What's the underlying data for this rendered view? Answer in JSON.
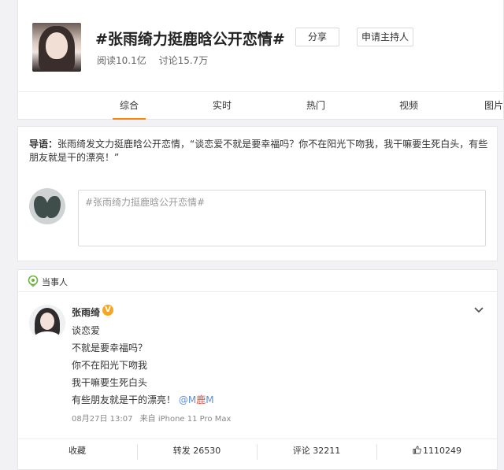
{
  "topic": {
    "title": "#张雨绮力挺鹿晗公开恋情#",
    "share_label": "分享",
    "apply_host_label": "申请主持人",
    "reads": "阅读10.1亿",
    "discussions": "讨论15.7万"
  },
  "tabs": [
    {
      "label": "综合",
      "active": true
    },
    {
      "label": "实时",
      "active": false
    },
    {
      "label": "热门",
      "active": false
    },
    {
      "label": "视频",
      "active": false
    },
    {
      "label": "图片",
      "active": false
    }
  ],
  "intro": {
    "prefix": "导语：",
    "text": "张雨绮发文力挺鹿晗公开恋情，“谈恋爱不就是要幸福吗？你不在阳光下吻我，我干嘛要生死白头，有些朋友就是干的漂亮！”"
  },
  "composer": {
    "placeholder": "#张雨绮力挺鹿晗公开恋情#"
  },
  "post": {
    "section_label": "当事人",
    "author": "张雨绮",
    "verified_badge": "V",
    "lines": [
      "谈恋爱",
      "不就是要幸福吗？",
      "你不在阳光下吻我",
      "我干嘛要生死白头",
      "有些朋友就是干的漂亮！"
    ],
    "mention_prefix": "@M",
    "mention_middle": "鹿",
    "mention_suffix": "M",
    "date": "08月27日 13:07",
    "source": "来自 iPhone 11 Pro Max",
    "actions": {
      "favorite": "收藏",
      "repost": "转发 26530",
      "comment": "评论 32211",
      "like": "1110249"
    }
  },
  "colors": {
    "accent": "#ff8200",
    "link": "#5b8ede",
    "badge": "#f6a623"
  }
}
